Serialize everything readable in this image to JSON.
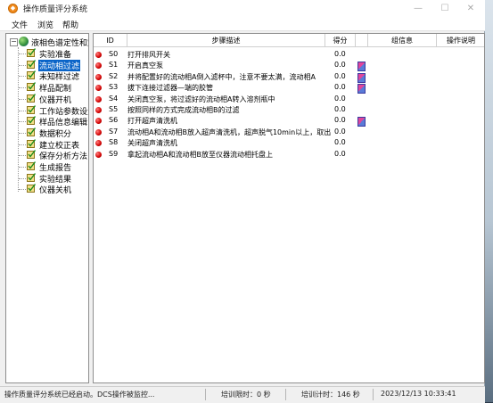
{
  "window": {
    "title": "操作质量评分系统"
  },
  "menu": [
    "文件",
    "浏览",
    "帮助"
  ],
  "tree": {
    "root": "液相色谱定性和定",
    "items": [
      {
        "label": "实验准备",
        "selected": false
      },
      {
        "label": "流动相过滤",
        "selected": true
      },
      {
        "label": "未知样过滤",
        "selected": false
      },
      {
        "label": "样品配制",
        "selected": false
      },
      {
        "label": "仪器开机",
        "selected": false
      },
      {
        "label": "工作站参数设置",
        "selected": false
      },
      {
        "label": "样品信息编辑",
        "selected": false
      },
      {
        "label": "数据积分",
        "selected": false
      },
      {
        "label": "建立校正表",
        "selected": false
      },
      {
        "label": "保存分析方法",
        "selected": false
      },
      {
        "label": "生成报告",
        "selected": false
      },
      {
        "label": "实验结果",
        "selected": false
      },
      {
        "label": "仪器关机",
        "selected": false
      }
    ]
  },
  "table": {
    "headers": [
      "ID",
      "步骤描述",
      "得分",
      "组信息",
      "操作说明"
    ],
    "rows": [
      {
        "id": "S0",
        "step": "打开排风开关",
        "score": "0.0",
        "group": false
      },
      {
        "id": "S1",
        "step": "开启真空泵",
        "score": "0.0",
        "group": true
      },
      {
        "id": "S2",
        "step": "并将配置好的流动相A倒入滤杯中，注意不要太满，流动相A",
        "score": "0.0",
        "group": true
      },
      {
        "id": "S3",
        "step": "拔下连接过滤器—端的胶管",
        "score": "0.0",
        "group": true
      },
      {
        "id": "S4",
        "step": "关闭真空泵，将过滤好的流动相A转入溶剂瓶中",
        "score": "0.0",
        "group": false
      },
      {
        "id": "S5",
        "step": "按照同样的方式完成流动相B的过滤",
        "score": "0.0",
        "group": false
      },
      {
        "id": "S6",
        "step": "打开超声清洗机",
        "score": "0.0",
        "group": true
      },
      {
        "id": "S7",
        "step": "流动相A和流动相B放入超声清洗机，超声脱气10min以上，取出",
        "score": "0.0",
        "group": false
      },
      {
        "id": "S8",
        "step": "关闭超声清洗机",
        "score": "0.0",
        "group": false
      },
      {
        "id": "S9",
        "step": "拿起流动相A和流动相B放至仪器流动相托盘上",
        "score": "0.0",
        "group": false
      }
    ]
  },
  "status": {
    "message": "操作质量评分系统已经启动。DCS操作被监控...",
    "train_limit": "培训限时：0 秒",
    "train_timer": "培训计时：146 秒",
    "datetime": "2023/12/13 10:33:41"
  }
}
